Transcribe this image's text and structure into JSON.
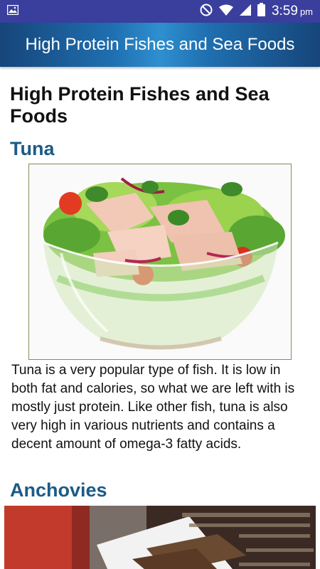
{
  "status_bar": {
    "time": "3:59",
    "ampm": "pm",
    "icons": [
      "image-notification-icon",
      "do-not-disturb-icon",
      "wifi-icon",
      "signal-icon",
      "battery-icon"
    ]
  },
  "app_bar": {
    "title": "High Protein Fishes and Sea Foods"
  },
  "article": {
    "title": "High Protein Fishes and Sea Foods",
    "sections": [
      {
        "heading": "Tuna",
        "description": "Tuna is a very popular type of fish. It is low in both fat and calories, so what we are left with is mostly just protein. Like other fish, tuna is also very high in various nutrients and contains a decent amount of omega-3 fatty acids."
      },
      {
        "heading": "Anchovies"
      }
    ]
  },
  "colors": {
    "status_bar": "#3a3f9e",
    "app_bar": "#1f6fb0",
    "heading": "#1b5b86"
  }
}
